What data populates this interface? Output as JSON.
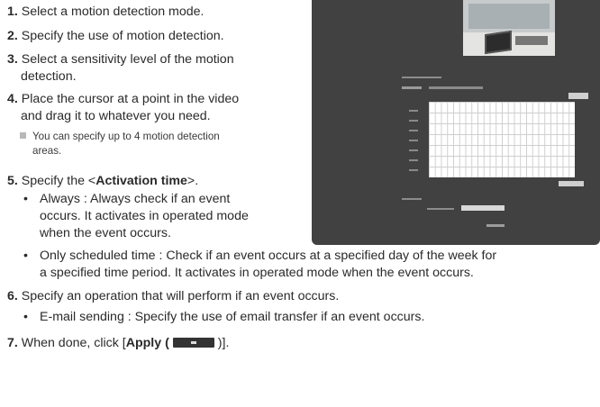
{
  "steps": [
    {
      "num": "1.",
      "text": "Select a motion detection mode."
    },
    {
      "num": "2.",
      "text": "Specify the use of motion detection."
    },
    {
      "num": "3.",
      "line1": "Select a sensitivity level of the motion",
      "line2": "detection."
    },
    {
      "num": "4.",
      "line1": "Place the cursor at a point in the video",
      "line2": "and drag it to whatever you need."
    },
    {
      "num": "5.",
      "prefix": "Specify the <",
      "bold": "Activation time",
      "suffix": ">."
    },
    {
      "num": "6.",
      "text": "Specify an operation that will perform if an event occurs."
    },
    {
      "num": "7.",
      "prefix": "When done, click [",
      "bold": "Apply (",
      "suffix": ")]."
    }
  ],
  "note": {
    "line1": "You can specify up to 4 motion detection",
    "line2": "areas."
  },
  "bullets": {
    "always": {
      "line1": "Always : Always check if an event",
      "line2": "occurs. It activates in operated mode",
      "line3": "when the event occurs."
    },
    "scheduled": {
      "line1": "Only scheduled time : Check if an event occurs at a specified day of the week for",
      "line2": "a specified time period. It activates in operated mode when the event occurs."
    },
    "email": {
      "text": "E-mail sending : Specify the use of email transfer if an event occurs."
    }
  },
  "icons": {
    "bullet": "bullet-dot-icon",
    "note": "note-square-icon",
    "apply": "apply-button-icon"
  },
  "colors": {
    "panel_bg": "#414141",
    "text": "#2a2a2a"
  }
}
